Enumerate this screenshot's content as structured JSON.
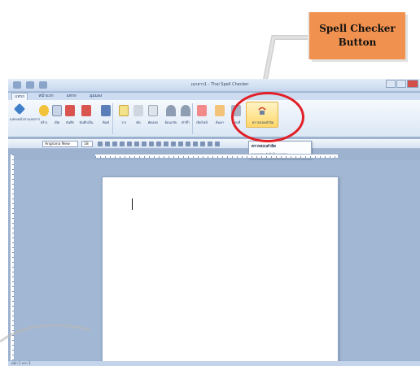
{
  "callout": {
    "line1": "Spell Checker",
    "line2": "Button",
    "color": "#f0914f"
  },
  "window": {
    "title": "เอกสาร1 - Thai Spell Checker"
  },
  "tabs": [
    "แทรก",
    "หน้าแรก",
    "แทรก",
    "มุมมอง"
  ],
  "ribbon": {
    "buttons": [
      "แสดงหน้าต่างเอกสาร",
      "สร้าง",
      "เปิด",
      "บันทึก",
      "บันทึกเป็น",
      "พิมพ์",
      "วาง",
      "ตัด",
      "คัดลอก",
      "ย้อนกลับ",
      "ทำซ้ำ",
      "เปิดไฟล์",
      "ค้นหา",
      "แทนที่",
      "ตรวจสอบคำผิด"
    ],
    "spell_label": "ตรวจสอบคำผิด"
  },
  "format": {
    "font": "Angsana New",
    "size": "18"
  },
  "tooltip": {
    "title": "ตรวจสอบคำผิด",
    "desc": "ตรวจสอบคำผิดในเอกสาร"
  },
  "status": {
    "text": "หน้า 1 จาก 1"
  },
  "accent": {
    "highlight": "#e21f26",
    "ribbon_bg": "#dbe7f5"
  }
}
